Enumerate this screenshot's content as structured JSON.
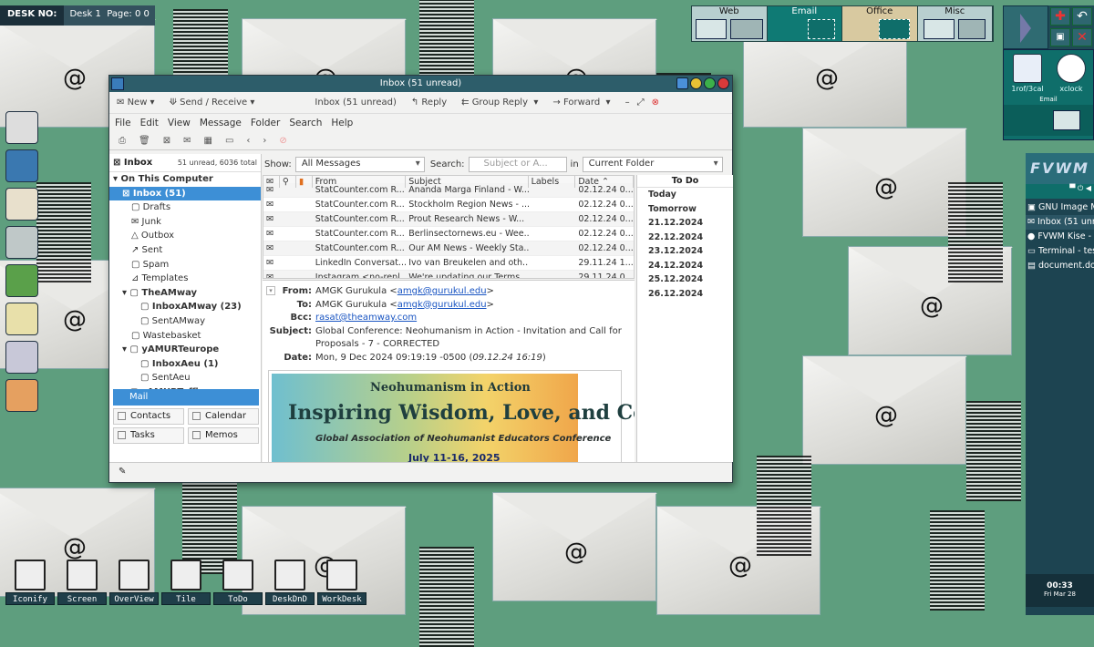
{
  "desk": {
    "label": "DESK NO:",
    "desk": "Desk 1",
    "page": "Page: 0 0"
  },
  "pager": [
    "Web",
    "Email",
    "Office",
    "Misc"
  ],
  "right_apps": [
    {
      "label": "1rof/3cal"
    },
    {
      "label": "xclock"
    }
  ],
  "right_email": "Email",
  "fvwm": "FVWM",
  "tasks": [
    "GNU Image M",
    "Inbox (51 unre",
    "FVWM Kise - /",
    "Terminal - tes",
    "document.doc"
  ],
  "clock": {
    "time": "00:33",
    "date": "Fri Mar 28"
  },
  "bottom_tools": [
    "Iconify",
    "Screen",
    "OverView",
    "Tile",
    "ToDo",
    "DeskDnD",
    "WorkDesk"
  ],
  "window": {
    "title": "Inbox (51 unread)",
    "toolbar": {
      "new": "New",
      "send_receive": "Send / Receive",
      "inbox_label": "Inbox (51 unread)",
      "reply": "Reply",
      "group_reply": "Group Reply",
      "forward": "Forward"
    },
    "menu": [
      "File",
      "Edit",
      "View",
      "Message",
      "Folder",
      "Search",
      "Help"
    ],
    "folders_head": {
      "name": "Inbox",
      "count": "51 unread, 6036 total"
    },
    "folders": [
      {
        "label": "On This Computer",
        "indent": 4,
        "cls": "b",
        "prefix": "▾ "
      },
      {
        "label": "Inbox (51)",
        "indent": 14,
        "cls": "sel",
        "prefix": "⊠ "
      },
      {
        "label": "Drafts",
        "indent": 24,
        "cls": "",
        "prefix": "▢ "
      },
      {
        "label": "Junk",
        "indent": 24,
        "cls": "",
        "prefix": "✉ "
      },
      {
        "label": "Outbox",
        "indent": 24,
        "cls": "",
        "prefix": "△ "
      },
      {
        "label": "Sent",
        "indent": 24,
        "cls": "",
        "prefix": "↗ "
      },
      {
        "label": "Spam",
        "indent": 24,
        "cls": "",
        "prefix": "▢ "
      },
      {
        "label": "Templates",
        "indent": 24,
        "cls": "",
        "prefix": "⊿ "
      },
      {
        "label": "TheAMway",
        "indent": 14,
        "cls": "b",
        "prefix": "▾ ▢ "
      },
      {
        "label": "InboxAMway (23)",
        "indent": 34,
        "cls": "b",
        "prefix": "▢ "
      },
      {
        "label": "SentAMway",
        "indent": 34,
        "cls": "",
        "prefix": "▢ "
      },
      {
        "label": "Wastebasket",
        "indent": 24,
        "cls": "",
        "prefix": "▢ "
      },
      {
        "label": "yAMURTeurope",
        "indent": 14,
        "cls": "b",
        "prefix": "▾ ▢ "
      },
      {
        "label": "InboxAeu (1)",
        "indent": 34,
        "cls": "b",
        "prefix": "▢ "
      },
      {
        "label": "SentAeu",
        "indent": 34,
        "cls": "",
        "prefix": "▢ "
      },
      {
        "label": "zAMURToffice",
        "indent": 14,
        "cls": "b",
        "prefix": "▸ ▢ "
      }
    ],
    "switcher": {
      "mail": "Mail",
      "contacts": "Contacts",
      "calendar": "Calendar",
      "tasks": "Tasks",
      "memos": "Memos"
    },
    "search": {
      "show_label": "Show:",
      "show_value": "All Messages",
      "search_label": "Search:",
      "placeholder": "Subject or A...",
      "in_label": "in",
      "scope": "Current Folder"
    },
    "columns": [
      "From",
      "Subject",
      "Labels",
      "Date"
    ],
    "messages": [
      {
        "from": "StatCounter.com R...",
        "subject": "Ananda Marga Finland - W...",
        "date": "02.12.24 0..."
      },
      {
        "from": "StatCounter.com R...",
        "subject": "Stockholm Region News - ...",
        "date": "02.12.24 0..."
      },
      {
        "from": "StatCounter.com R...",
        "subject": "Prout Research News - W...",
        "date": "02.12.24 0..."
      },
      {
        "from": "StatCounter.com R...",
        "subject": "Berlinsectornews.eu - Wee...",
        "date": "02.12.24 0..."
      },
      {
        "from": "StatCounter.com R...",
        "subject": "Our AM News - Weekly Sta...",
        "date": "02.12.24 0..."
      },
      {
        "from": "LinkedIn Conversat...",
        "subject": "Ivo van Breukelen and oth...",
        "date": "29.11.24 1..."
      },
      {
        "from": "Instagram <no-repl...",
        "subject": "We're updating our Terms...",
        "date": "29.11.24 0..."
      }
    ],
    "todo": {
      "title": "To Do",
      "days": [
        "Today",
        "Tomorrow",
        "21.12.2024",
        "22.12.2024",
        "23.12.2024",
        "24.12.2024",
        "25.12.2024",
        "26.12.2024"
      ]
    },
    "preview": {
      "from_k": "From:",
      "from": "AMGK Gurukula <",
      "from_link": "amgk@gurukul.edu",
      "from_end": ">",
      "to_k": "To:",
      "to": "AMGK Gurukula <",
      "to_link": "amgk@gurukul.edu",
      "to_end": ">",
      "bcc_k": "Bcc:",
      "bcc": "rasat@theamway.com",
      "subject_k": "Subject:",
      "subject": "Global Conference: Neohumanism in Action - Invitation and Call for Proposals - 7 - CORRECTED",
      "date_k": "Date:",
      "date": "Mon, 9 Dec 2024 09:19:19 -0500 (",
      "date_it": "09.12.24 16:19",
      "date_end": ")",
      "banner1": "Neohumanism in Action",
      "banner2": "Inspiring Wisdom, Love, and Courage",
      "banner3": "Global Association of Neohumanist Educators Conference",
      "banner4": "July 11-16, 2025"
    }
  }
}
